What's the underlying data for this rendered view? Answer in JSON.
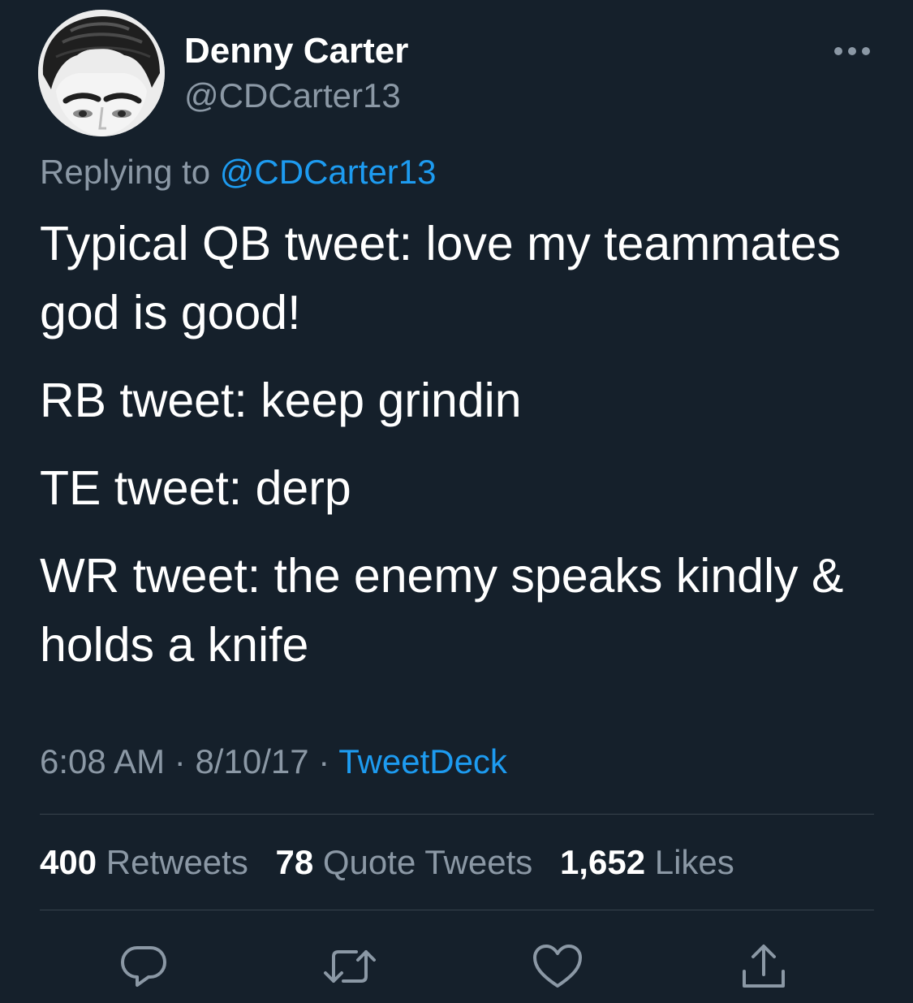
{
  "author": {
    "display_name": "Denny Carter",
    "handle": "@CDCarter13",
    "avatar_icon": "cartoon-face-avatar"
  },
  "reply": {
    "prefix": "Replying to",
    "mention": "@CDCarter13"
  },
  "tweet": {
    "paragraphs": [
      "Typical QB tweet: love my teammates god is good!",
      "RB tweet: keep grindin",
      "TE tweet: derp",
      "WR tweet: the enemy speaks kindly & holds a knife"
    ]
  },
  "meta": {
    "time": "6:08 AM",
    "separator": "·",
    "date": "8/10/17",
    "source": "TweetDeck"
  },
  "stats": {
    "retweets": {
      "count": "400",
      "label": "Retweets"
    },
    "quotes": {
      "count": "78",
      "label": "Quote Tweets"
    },
    "likes": {
      "count": "1,652",
      "label": "Likes"
    }
  },
  "icons": {
    "more": "more-horizontal-icon",
    "reply": "reply-icon",
    "retweet": "retweet-icon",
    "like": "heart-icon",
    "share": "share-icon"
  },
  "colors": {
    "background": "#15202b",
    "primary_text": "#ffffff",
    "secondary_text": "#8b98a5",
    "accent": "#1d9bf0",
    "divider": "#38444d"
  }
}
